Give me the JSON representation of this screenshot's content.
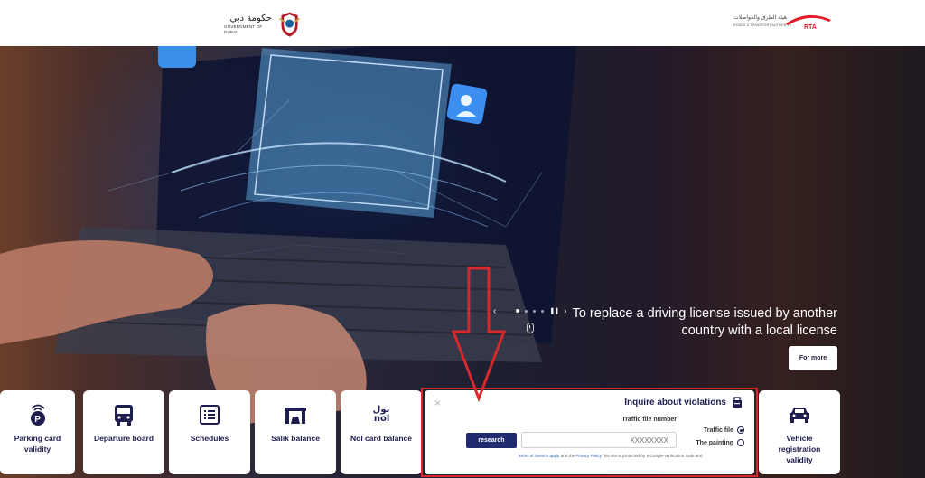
{
  "header": {
    "gov_arabic": "حكومة دبي",
    "gov_english": "GOVERNMENT OF DUBAI",
    "rta_arabic": "هيئة الطرق والمواصلات",
    "rta_english": "ROADS & TRANSPORT AUTHORITY",
    "rta_mark": "RTA"
  },
  "hero": {
    "caption_line1": "To replace a driving license issued by another",
    "caption_line2": "country with a local license",
    "for_more_label": "For more",
    "prev_label": "‹",
    "next_label": "›",
    "pause_label": "❚❚"
  },
  "cards": [
    {
      "label_line1": "Parking card",
      "label_line2": "validity",
      "icon": "parking-icon"
    },
    {
      "label_line1": "Departure board",
      "label_line2": "",
      "icon": "bus-icon"
    },
    {
      "label_line1": "Schedules",
      "label_line2": "",
      "icon": "schedule-list-icon"
    },
    {
      "label_line1": "Salik balance",
      "label_line2": "",
      "icon": "salik-gate-icon"
    },
    {
      "label_line1": "Nol card balance",
      "label_line2": "",
      "icon": "nol-logo-icon",
      "logo_ar": "نول",
      "logo_en": "nol"
    },
    {
      "label_line1": "Vehicle",
      "label_line2": "registration",
      "label_line3": "validity",
      "icon": "car-icon"
    }
  ],
  "violations": {
    "title": "Inquire about violations",
    "close": "×",
    "file_number_label": "Traffic file number",
    "input_placeholder": "XXXXXXXX",
    "research_label": "research",
    "options": [
      {
        "label": "Traffic file",
        "checked": true
      },
      {
        "label": "The painting",
        "checked": false
      }
    ],
    "legal_terms": "Terms of Service apply",
    "legal_and": " and the ",
    "legal_privacy": "Privacy Policy",
    "legal_rest": "This site is protected by a Google verification code and"
  },
  "colors": {
    "brand_navy": "#1d1d4e",
    "button_navy": "#1f2b6e",
    "annotation_red": "#d9272e",
    "rta_red": "#e11d2a"
  }
}
